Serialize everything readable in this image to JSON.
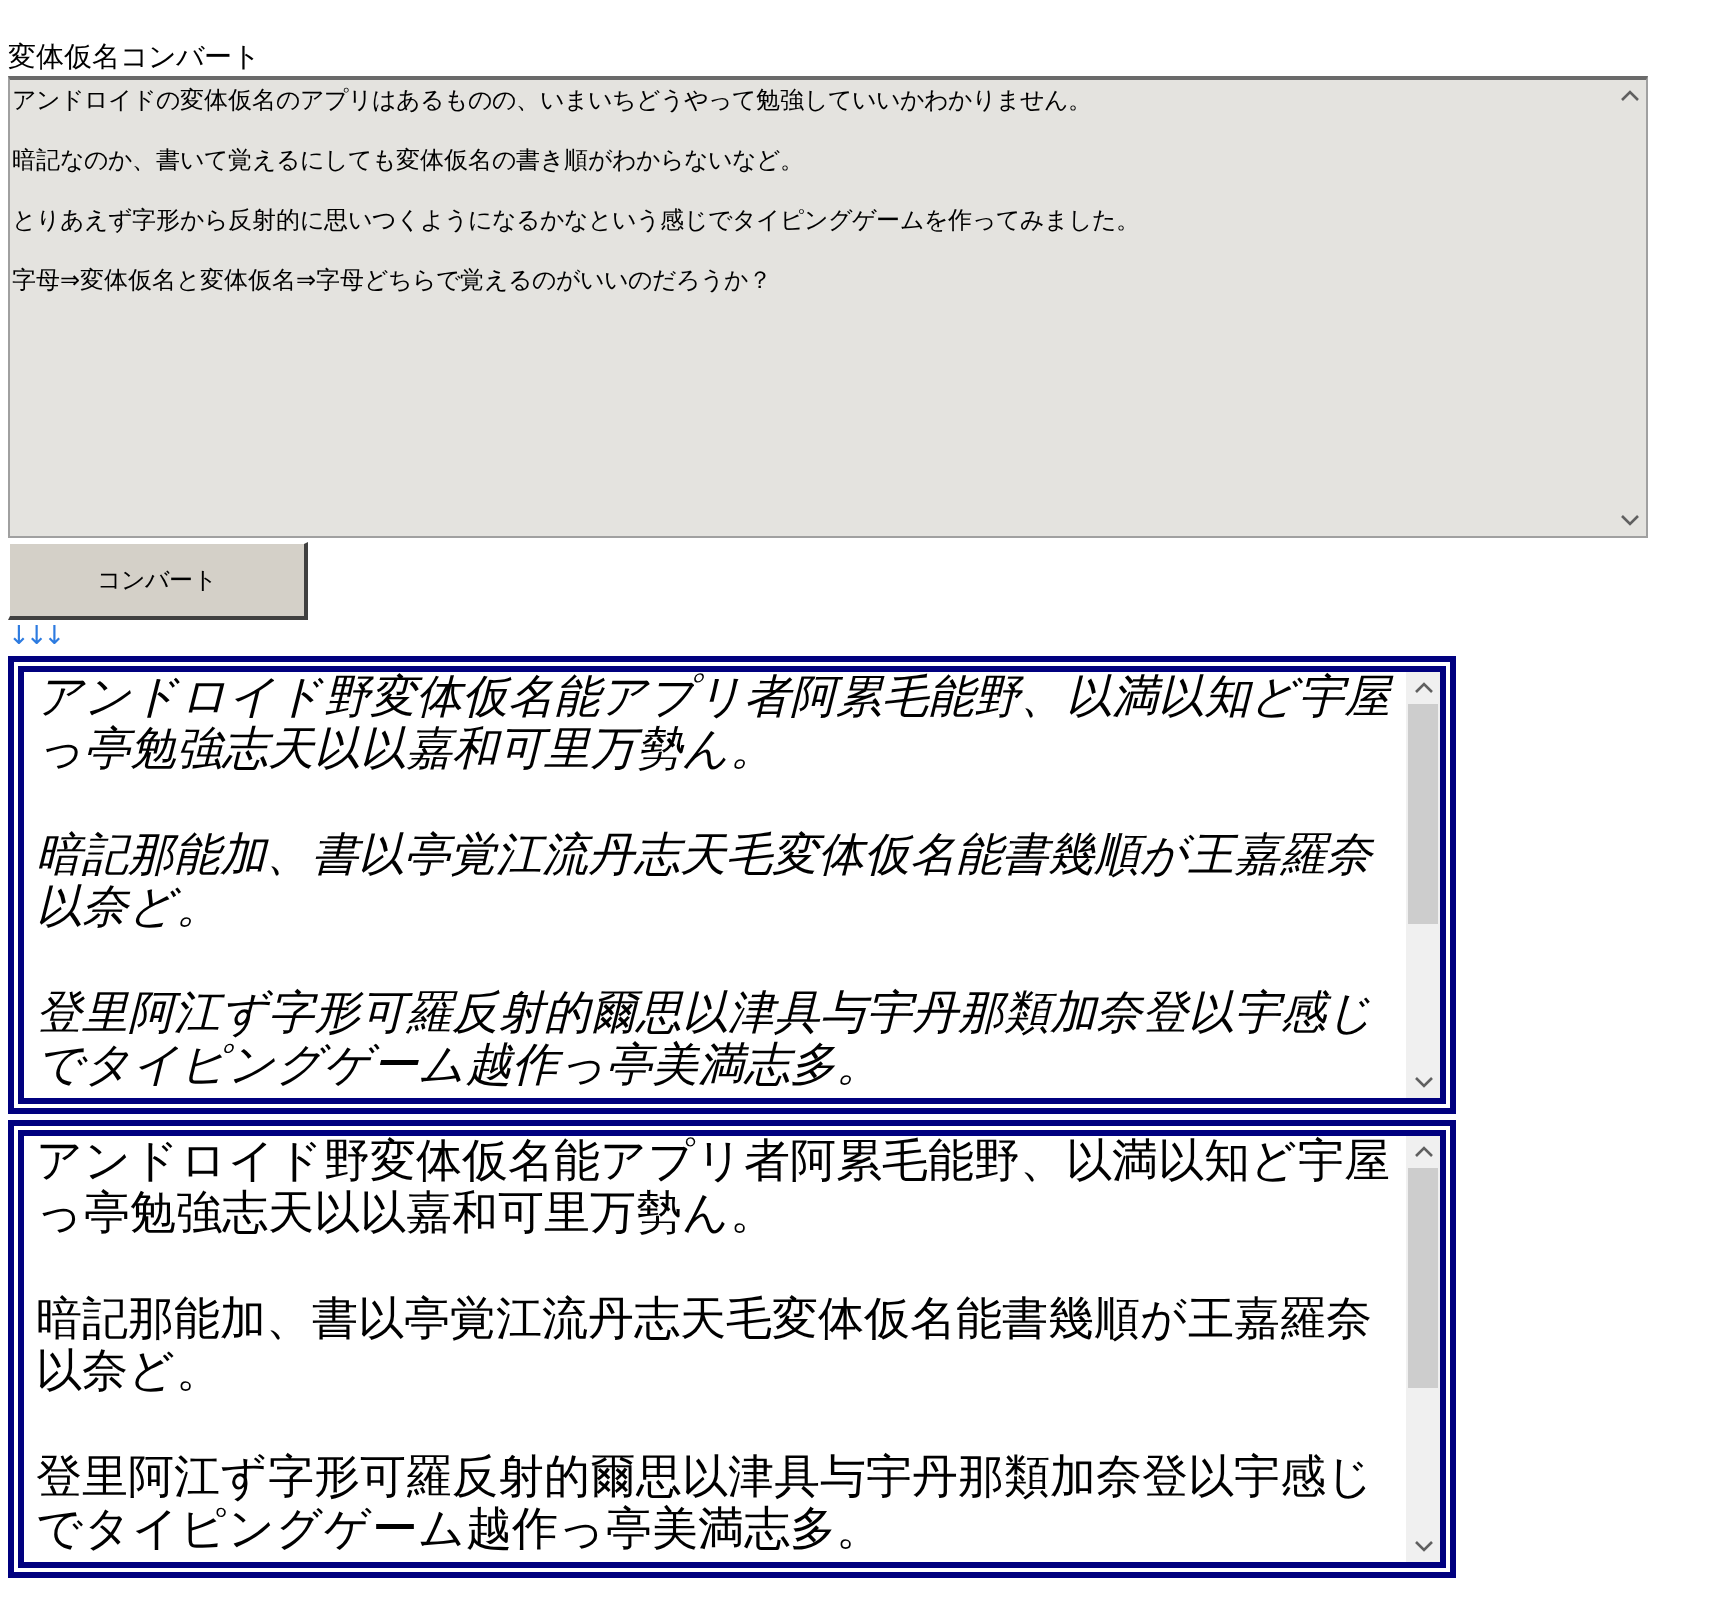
{
  "title": "変体仮名コンバート",
  "input": {
    "paragraphs": [
      "アンドロイドの変体仮名のアプリはあるものの、いまいちどうやって勉強していいかわかりません。",
      "暗記なのか、書いて覚えるにしても変体仮名の書き順がわからないなど。",
      "とりあえず字形から反射的に思いつくようになるかなという感じでタイピングゲームを作ってみました。",
      "字母⇒変体仮名と変体仮名⇒字母どちらで覚えるのがいいのだろうか？"
    ]
  },
  "convert_button": "コンバート",
  "arrows": "↓↓↓",
  "outputs": [
    {
      "kind": "hentaigana",
      "paragraphs": [
        "アンドロイド野変体仮名能アプリ者阿累毛能野、以満以知ど宇屋っ亭勉強志天以以嘉和可里万勢ん。",
        "暗記那能加、書以亭覚江流丹志天毛変体仮名能書幾順が王嘉羅奈以奈ど。",
        "登里阿江ず字形可羅反射的爾思以津具与宇丹那類加奈登以宇感じでタイピングゲーム越作っ亭美満志多。"
      ]
    },
    {
      "kind": "kanji",
      "paragraphs": [
        "アンドロイド野変体仮名能アプリ者阿累毛能野、以満以知ど宇屋っ亭勉強志天以以嘉和可里万勢ん。",
        "暗記那能加、書以亭覚江流丹志天毛変体仮名能書幾順が王嘉羅奈以奈ど。",
        "登里阿江ず字形可羅反射的爾思以津具与宇丹那類加奈登以宇感じでタイピングゲーム越作っ亭美満志多。"
      ]
    }
  ]
}
